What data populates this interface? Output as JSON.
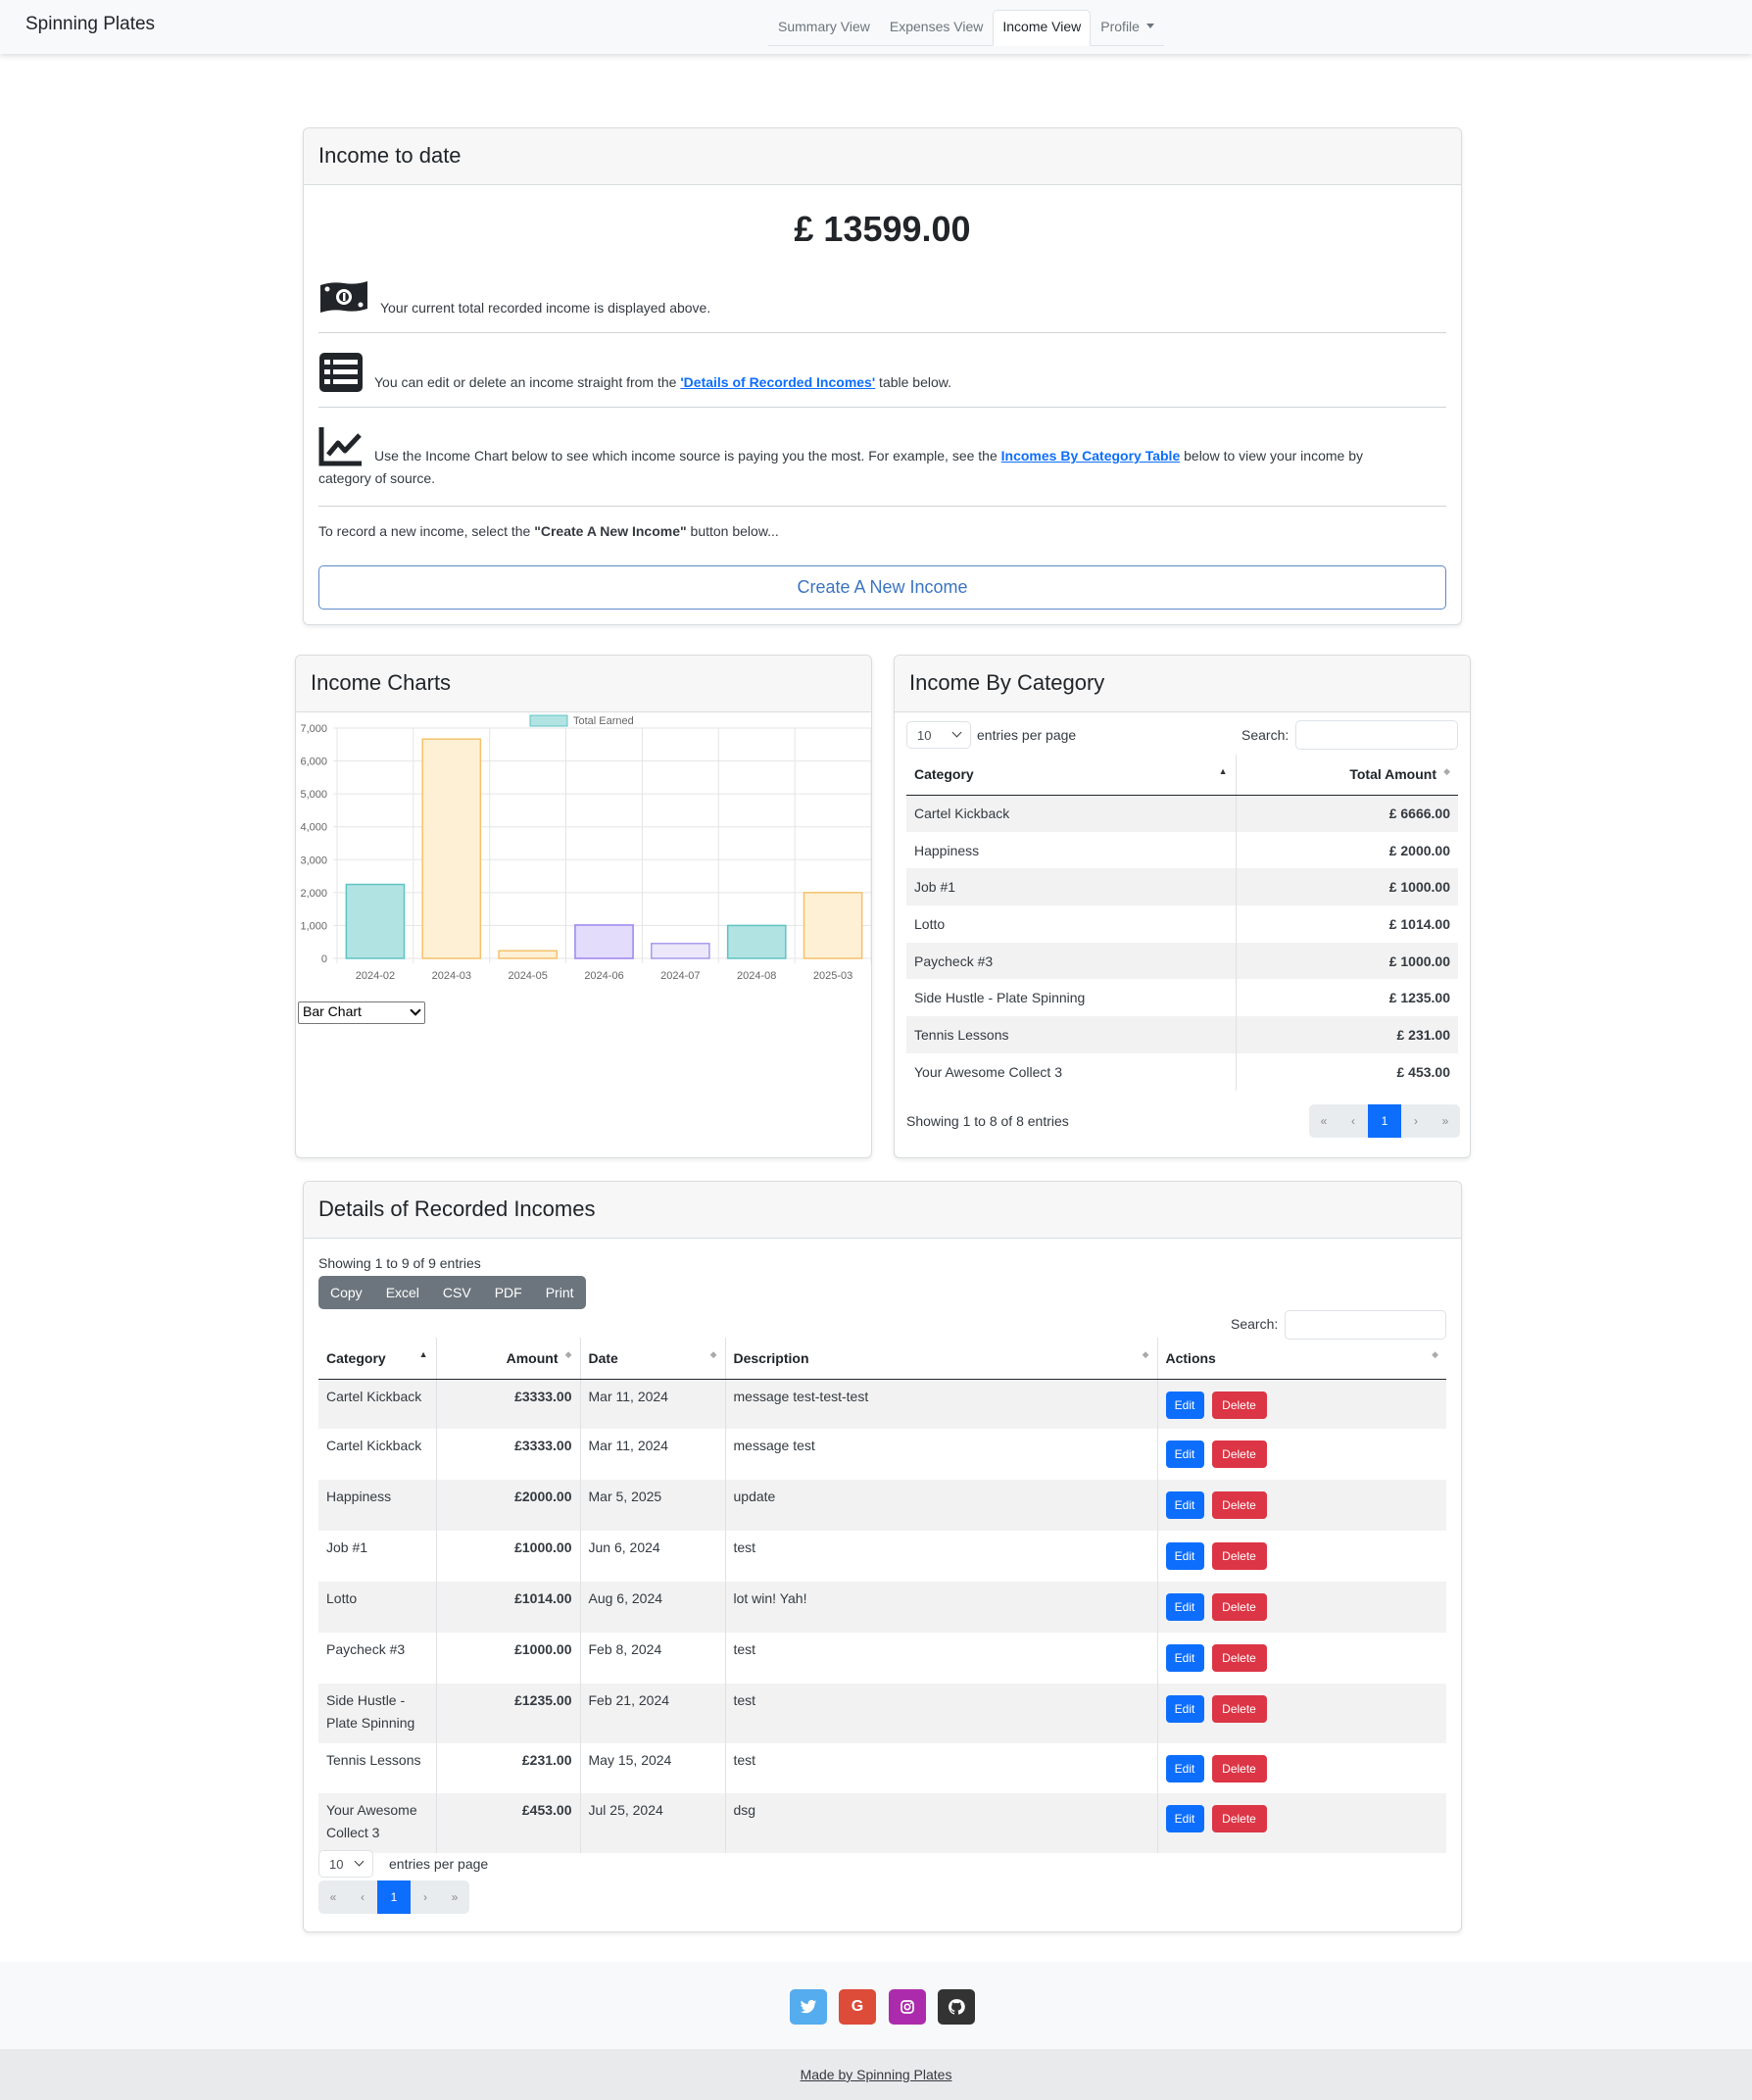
{
  "navbar": {
    "brand": "Spinning Plates",
    "tabs": [
      "Summary View",
      "Expenses View",
      "Income View",
      "Profile"
    ],
    "active_tab": "Income View"
  },
  "income_card": {
    "title": "Income to date",
    "total": "£ 13599.00",
    "line1": "Your current total recorded income is displayed above.",
    "line2_pre": "You can edit or delete an income straight from the ",
    "line2_link": "'Details of Recorded Incomes'",
    "line2_post": " table below.",
    "line3_pre": "Use the Income Chart below to see which income source is paying you the most. For example, see the ",
    "line3_link": "Incomes By Category Table",
    "line3_post": " below to view your income by",
    "line3_cont": "category of source.",
    "line4_pre": "To record a new income, select the ",
    "line4_bold": "\"Create A New Income\"",
    "line4_post": " button below...",
    "create_button": "Create A New Income"
  },
  "chart_card": {
    "title": "Income Charts",
    "chart_type_select": "Bar Chart"
  },
  "chart_data": {
    "type": "bar",
    "categories": [
      "2024-02",
      "2024-03",
      "2024-05",
      "2024-06",
      "2024-07",
      "2024-08",
      "2025-03"
    ],
    "series": [
      {
        "name": "Total Earned",
        "values": [
          2248,
          6666,
          231,
          1014,
          453,
          1000,
          2000
        ]
      }
    ],
    "bar_fills": [
      "#b2e3e3",
      "#fdf0d5",
      "#fdf0d5",
      "#e3dcfb",
      "#ece8fa",
      "#b2e3e3",
      "#fdf0d5"
    ],
    "bar_strokes": [
      "#5fc3c3",
      "#f5c16b",
      "#f5c16b",
      "#9c84ee",
      "#a99af0",
      "#5fc3c3",
      "#f5c16b"
    ],
    "ylim": [
      0,
      7000
    ],
    "yticks": [
      "7,000",
      "6,000",
      "5,000",
      "4,000",
      "3,000",
      "2,000",
      "1,000",
      "0"
    ],
    "legend_position": "top",
    "grid": true
  },
  "category_card": {
    "title": "Income By Category",
    "entries_value": "10",
    "entries_label": "entries per page",
    "search_label": "Search:",
    "columns": [
      "Category",
      "Total Amount"
    ],
    "rows": [
      [
        "Cartel Kickback",
        "£ 6666.00"
      ],
      [
        "Happiness",
        "£ 2000.00"
      ],
      [
        "Job #1",
        "£ 1000.00"
      ],
      [
        "Lotto",
        "£ 1014.00"
      ],
      [
        "Paycheck #3",
        "£ 1000.00"
      ],
      [
        "Side Hustle - Plate Spinning",
        "£ 1235.00"
      ],
      [
        "Tennis Lessons",
        "£ 231.00"
      ],
      [
        "Your Awesome Collect 3",
        "£ 453.00"
      ]
    ],
    "info": "Showing 1 to 8 of 8 entries",
    "pager": [
      "«",
      "‹",
      "1",
      "›",
      "»"
    ]
  },
  "details_card": {
    "title": "Details of Recorded Incomes",
    "info": "Showing 1 to 9 of 9 entries",
    "export_buttons": [
      "Copy",
      "Excel",
      "CSV",
      "PDF",
      "Print"
    ],
    "search_label": "Search:",
    "columns": [
      "Category",
      "Amount",
      "Date",
      "Description",
      "Actions"
    ],
    "rows": [
      {
        "category": "Cartel Kickback",
        "amount": "£3333.00",
        "date": "Mar 11, 2024",
        "description": "message test-test-test"
      },
      {
        "category": "Cartel Kickback",
        "amount": "£3333.00",
        "date": "Mar 11, 2024",
        "description": "message test"
      },
      {
        "category": "Happiness",
        "amount": "£2000.00",
        "date": "Mar 5, 2025",
        "description": "update"
      },
      {
        "category": "Job #1",
        "amount": "£1000.00",
        "date": "Jun 6, 2024",
        "description": "test"
      },
      {
        "category": "Lotto",
        "amount": "£1014.00",
        "date": "Aug 6, 2024",
        "description": "lot win! Yah!"
      },
      {
        "category": "Paycheck #3",
        "amount": "£1000.00",
        "date": "Feb 8, 2024",
        "description": "test"
      },
      {
        "category": "Side Hustle - Plate Spinning",
        "amount": "£1235.00",
        "date": "Feb 21, 2024",
        "description": "test"
      },
      {
        "category": "Tennis Lessons",
        "amount": "£231.00",
        "date": "May 15, 2024",
        "description": "test"
      },
      {
        "category": "Your Awesome Collect 3",
        "amount": "£453.00",
        "date": "Jul 25, 2024",
        "description": "dsg"
      }
    ],
    "edit_label": "Edit",
    "delete_label": "Delete",
    "entries_value": "10",
    "entries_label": "entries per page",
    "pager": [
      "«",
      "‹",
      "1",
      "›",
      "»"
    ]
  },
  "footer": {
    "social": [
      {
        "icon": "twitter-icon",
        "color": "#55acee"
      },
      {
        "icon": "google-icon",
        "color": "#dd4b39"
      },
      {
        "icon": "instagram-icon",
        "color": "#ac2bac"
      },
      {
        "icon": "github-icon",
        "color": "#333333"
      }
    ],
    "credit": "Made by Spinning Plates"
  }
}
